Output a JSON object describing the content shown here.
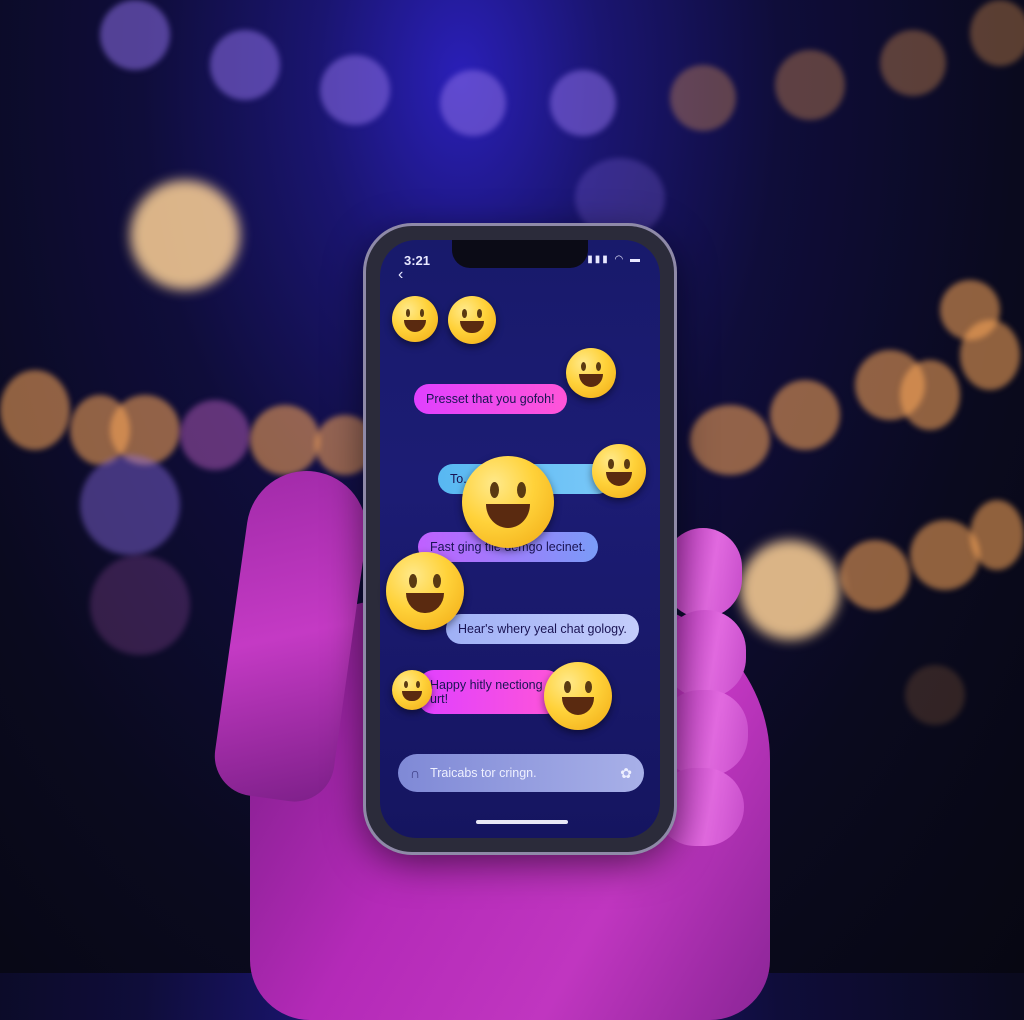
{
  "status_bar": {
    "time": "3:21",
    "signal_icon": "signal-icon",
    "wifi_icon": "wifi-icon",
    "battery_icon": "battery-icon"
  },
  "header": {
    "back_icon": "chevron-left-icon"
  },
  "messages": [
    {
      "text": "Presset that you gofoh!"
    },
    {
      "text": "To...  yocioe."
    },
    {
      "text": "Fast ging tlle demgo lecinet."
    },
    {
      "text": "Hear's whery yeal chat gology."
    },
    {
      "text": "Happy hitly nectiong urt!"
    }
  ],
  "composer": {
    "placeholder": "Traicabs tor cringn.",
    "mic_icon": "headphones-icon",
    "settings_icon": "gear-icon"
  },
  "colors": {
    "bubble_magenta": "#e040ff",
    "bubble_cyan": "#58b8f2",
    "bubble_lavender": "#9fb0f6",
    "screen_bg": "#1c1c74"
  }
}
